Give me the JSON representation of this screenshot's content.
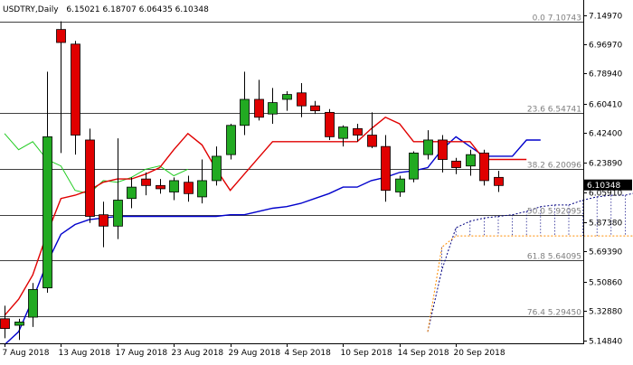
{
  "chart_data": {
    "type": "candlestick",
    "header": {
      "symbol": "USDTRY,Daily",
      "ohlc": "6.15021 6.18707 6.06435 6.10348"
    },
    "y_axis": {
      "range": [
        5.14,
        7.16
      ],
      "ticks": [
        "7.14970",
        "6.96970",
        "6.78940",
        "6.60410",
        "6.42400",
        "6.23890",
        "6.05910",
        "5.87380",
        "5.69390",
        "5.50860",
        "5.32880",
        "5.14840"
      ],
      "tick_values": [
        7.1497,
        6.9697,
        6.7894,
        6.6041,
        6.424,
        6.2389,
        6.0591,
        5.8738,
        5.6939,
        5.5086,
        5.3288,
        5.1484
      ]
    },
    "x_axis": {
      "labels": [
        "7 Aug 2018",
        "13 Aug 2018",
        "17 Aug 2018",
        "23 Aug 2018",
        "29 Aug 2018",
        "4 Sep 2018",
        "10 Sep 2018",
        "14 Sep 2018",
        "20 Sep 2018"
      ],
      "label_at_index": [
        0,
        4,
        8,
        12,
        16,
        20,
        24,
        28,
        32
      ]
    },
    "current_price": {
      "value": 6.10348,
      "label": "6.10348"
    },
    "fibonacci": [
      {
        "label": "0.0 7.10743",
        "value": 7.10743
      },
      {
        "label": "23.6 6.54741",
        "value": 6.54741
      },
      {
        "label": "38.2 6.20096",
        "value": 6.20096
      },
      {
        "label": "50.0 5.92095",
        "value": 5.92095
      },
      {
        "label": "61.8 5.64095",
        "value": 5.64095
      },
      {
        "label": "76.4 5.29450",
        "value": 5.2945
      }
    ],
    "candles": [
      {
        "o": 5.28,
        "h": 5.36,
        "l": 5.16,
        "c": 5.22
      },
      {
        "o": 5.24,
        "h": 5.28,
        "l": 5.15,
        "c": 5.26
      },
      {
        "o": 5.29,
        "h": 5.5,
        "l": 5.23,
        "c": 5.46
      },
      {
        "o": 5.47,
        "h": 6.8,
        "l": 5.44,
        "c": 6.4
      },
      {
        "o": 7.06,
        "h": 7.11,
        "l": 6.3,
        "c": 6.98
      },
      {
        "o": 6.97,
        "h": 6.99,
        "l": 6.29,
        "c": 6.41
      },
      {
        "o": 6.38,
        "h": 6.45,
        "l": 5.87,
        "c": 5.91
      },
      {
        "o": 5.92,
        "h": 6.0,
        "l": 5.72,
        "c": 5.85
      },
      {
        "o": 5.85,
        "h": 6.39,
        "l": 5.77,
        "c": 6.01
      },
      {
        "o": 6.02,
        "h": 6.15,
        "l": 5.96,
        "c": 6.09
      },
      {
        "o": 6.14,
        "h": 6.18,
        "l": 6.04,
        "c": 6.1
      },
      {
        "o": 6.1,
        "h": 6.14,
        "l": 6.05,
        "c": 6.08
      },
      {
        "o": 6.06,
        "h": 6.15,
        "l": 6.01,
        "c": 6.13
      },
      {
        "o": 6.12,
        "h": 6.16,
        "l": 6.0,
        "c": 6.05
      },
      {
        "o": 6.03,
        "h": 6.26,
        "l": 5.99,
        "c": 6.13
      },
      {
        "o": 6.13,
        "h": 6.34,
        "l": 6.1,
        "c": 6.28
      },
      {
        "o": 6.29,
        "h": 6.48,
        "l": 6.26,
        "c": 6.47
      },
      {
        "o": 6.47,
        "h": 6.8,
        "l": 6.41,
        "c": 6.63
      },
      {
        "o": 6.63,
        "h": 6.75,
        "l": 6.5,
        "c": 6.52
      },
      {
        "o": 6.54,
        "h": 6.7,
        "l": 6.48,
        "c": 6.61
      },
      {
        "o": 6.63,
        "h": 6.68,
        "l": 6.56,
        "c": 6.66
      },
      {
        "o": 6.67,
        "h": 6.73,
        "l": 6.52,
        "c": 6.59
      },
      {
        "o": 6.59,
        "h": 6.62,
        "l": 6.54,
        "c": 6.56
      },
      {
        "o": 6.55,
        "h": 6.57,
        "l": 6.38,
        "c": 6.4
      },
      {
        "o": 6.39,
        "h": 6.47,
        "l": 6.34,
        "c": 6.46
      },
      {
        "o": 6.45,
        "h": 6.48,
        "l": 6.37,
        "c": 6.41
      },
      {
        "o": 6.41,
        "h": 6.55,
        "l": 6.33,
        "c": 6.34
      },
      {
        "o": 6.34,
        "h": 6.41,
        "l": 6.0,
        "c": 6.07
      },
      {
        "o": 6.06,
        "h": 6.16,
        "l": 6.03,
        "c": 6.14
      },
      {
        "o": 6.14,
        "h": 6.31,
        "l": 6.12,
        "c": 6.3
      },
      {
        "o": 6.29,
        "h": 6.44,
        "l": 6.26,
        "c": 6.38
      },
      {
        "o": 6.38,
        "h": 6.41,
        "l": 6.18,
        "c": 6.26
      },
      {
        "o": 6.25,
        "h": 6.27,
        "l": 6.17,
        "c": 6.21
      },
      {
        "o": 6.22,
        "h": 6.32,
        "l": 6.16,
        "c": 6.29
      },
      {
        "o": 6.3,
        "h": 6.32,
        "l": 6.1,
        "c": 6.13
      },
      {
        "o": 6.15,
        "h": 6.19,
        "l": 6.06,
        "c": 6.1
      }
    ],
    "lines": {
      "tenkan": [
        5.3,
        5.4,
        5.55,
        5.8,
        6.02,
        6.04,
        6.07,
        6.12,
        6.14,
        6.14,
        6.17,
        6.21,
        6.32,
        6.42,
        6.35,
        6.2,
        6.07,
        6.17,
        6.27,
        6.37,
        6.37,
        6.37,
        6.37,
        6.37,
        6.37,
        6.37,
        6.45,
        6.52,
        6.48,
        6.37,
        6.37,
        6.37,
        6.37,
        6.37,
        6.26,
        6.26,
        6.26,
        6.26
      ],
      "kijun": [
        5.12,
        5.2,
        5.4,
        5.62,
        5.8,
        5.86,
        5.89,
        5.9,
        5.91,
        5.91,
        5.91,
        5.91,
        5.91,
        5.91,
        5.91,
        5.91,
        5.92,
        5.92,
        5.94,
        5.96,
        5.97,
        5.99,
        6.02,
        6.05,
        6.09,
        6.09,
        6.13,
        6.15,
        6.18,
        6.19,
        6.21,
        6.32,
        6.4,
        6.34,
        6.28,
        6.28,
        6.28,
        6.38,
        6.38
      ],
      "chikou": [
        6.42,
        6.32,
        6.37,
        6.26,
        6.22,
        6.07,
        6.05,
        6.13,
        6.12,
        6.15,
        6.2,
        6.22,
        6.16,
        6.2
      ],
      "senkou_a": [
        5.2,
        5.58,
        5.84,
        5.88,
        5.9,
        5.91,
        5.92,
        5.94,
        5.97,
        5.98,
        5.98,
        6.01,
        6.03,
        6.04,
        6.04,
        6.06,
        6.1,
        6.13,
        6.17,
        6.18,
        6.11,
        6.07,
        6.03
      ],
      "senkou_b": [
        5.2,
        5.72,
        5.79,
        5.79,
        5.79,
        5.79,
        5.79,
        5.79,
        5.79,
        5.79,
        5.79,
        5.79,
        5.79,
        5.79,
        5.79,
        5.79,
        5.79,
        5.79,
        5.79,
        5.8,
        5.81,
        5.81,
        5.81
      ]
    },
    "colors": {
      "up_body": "#22aa22",
      "down_body": "#e00000",
      "wick": "#000000",
      "tenkan": "#e00000",
      "kijun": "#0000cc",
      "chikou": "#22cc22",
      "senkou_a": "#000080",
      "senkou_b": "#ff8c00",
      "fib": "#000000",
      "price_tag_bg": "#000000",
      "price_tag_text": "#ffffff"
    }
  }
}
